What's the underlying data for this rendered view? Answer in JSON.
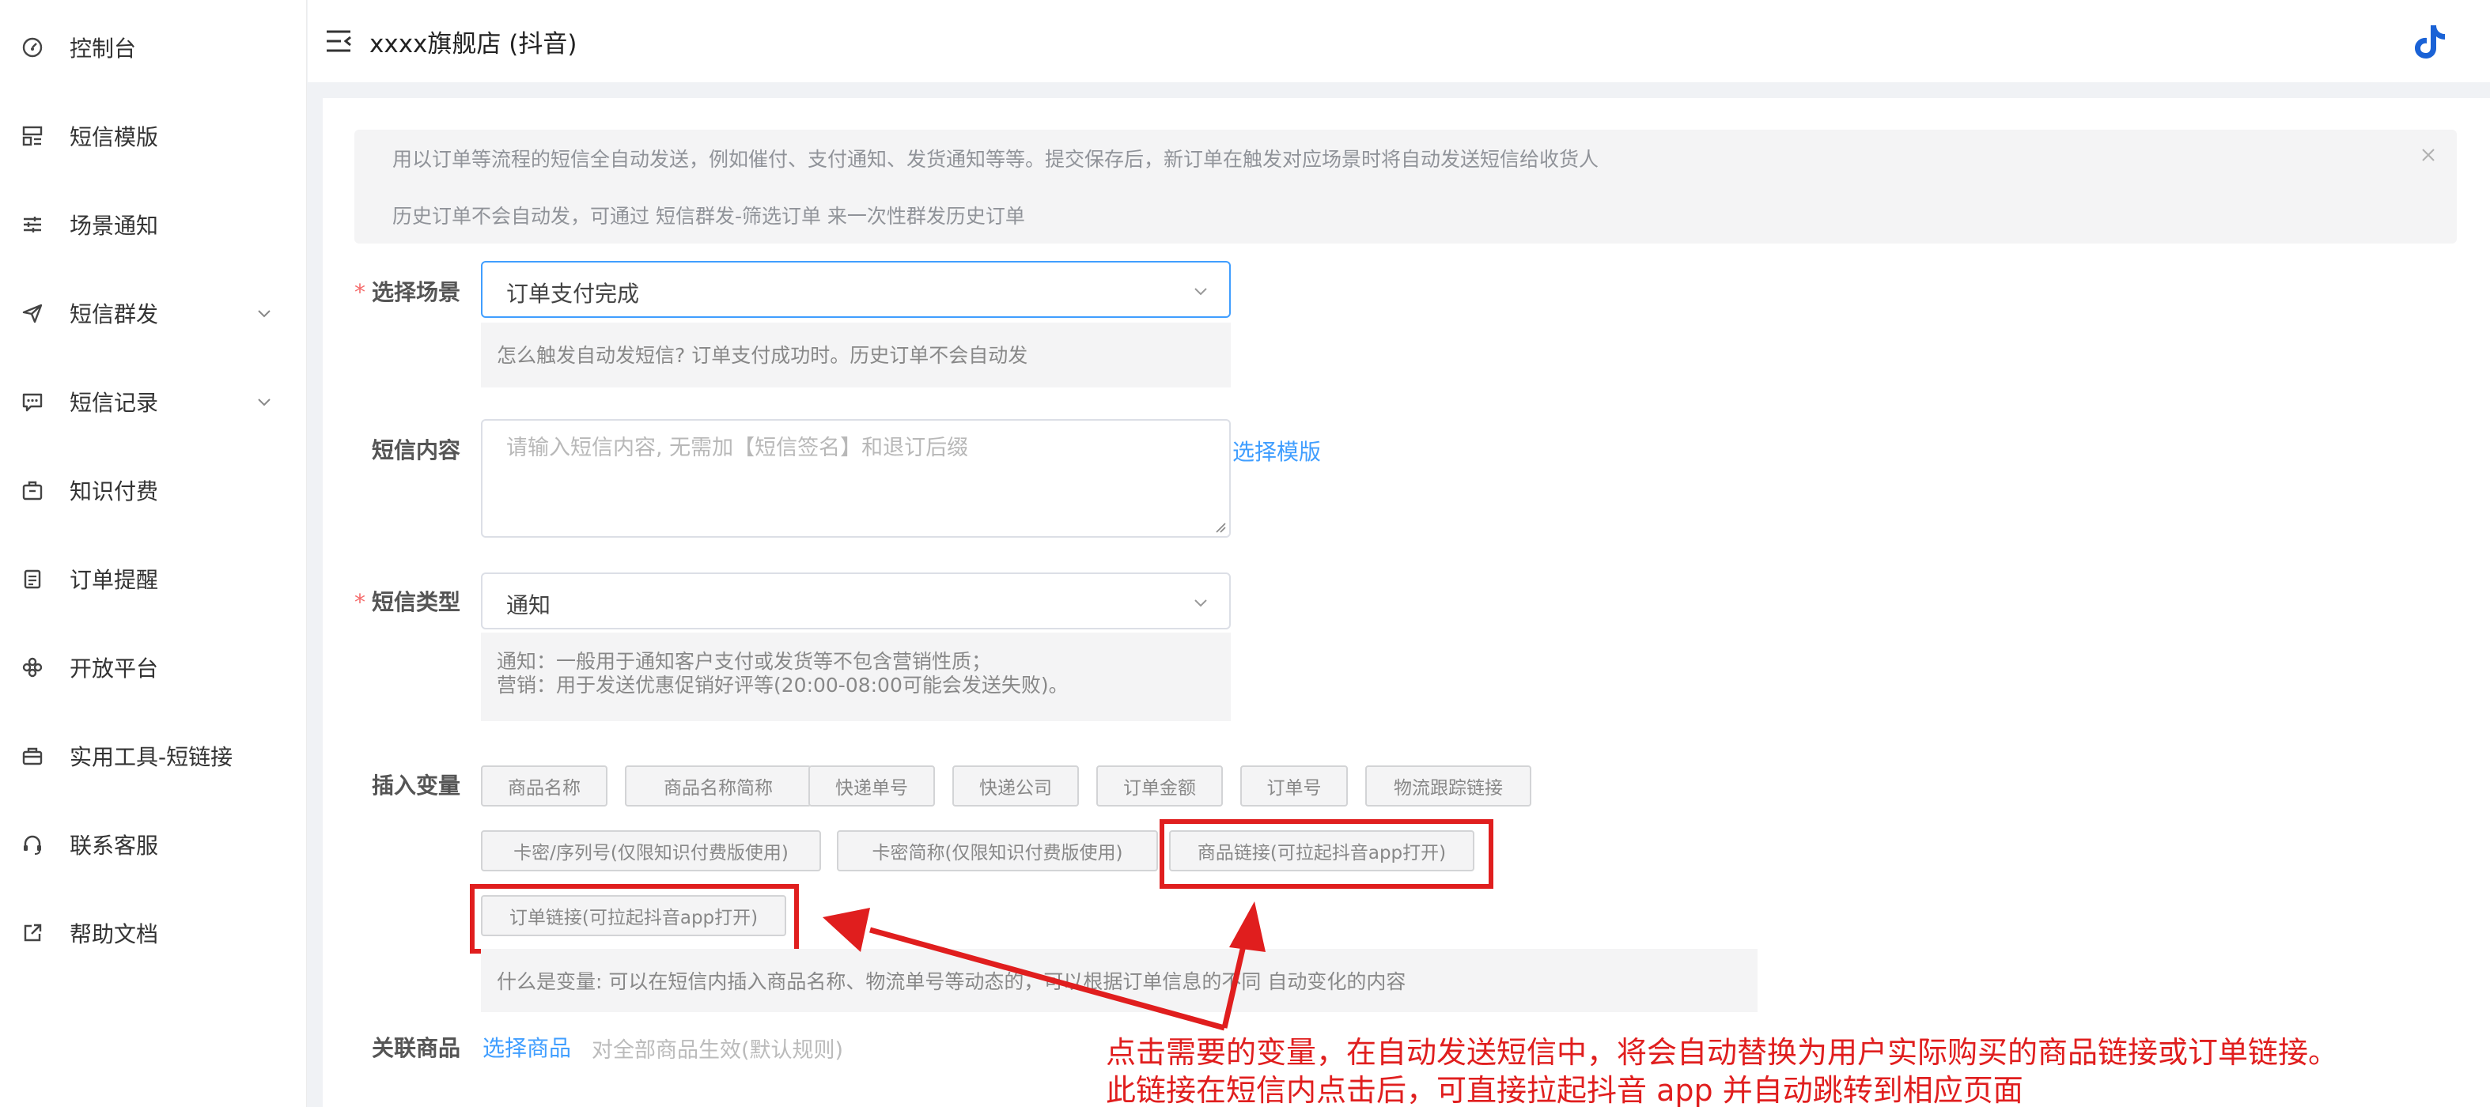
{
  "sidebar": {
    "items": [
      {
        "label": "控制台",
        "icon": "dashboard-icon"
      },
      {
        "label": "短信模版",
        "icon": "template-icon"
      },
      {
        "label": "场景通知",
        "icon": "sliders-icon"
      },
      {
        "label": "短信群发",
        "icon": "send-icon"
      },
      {
        "label": "短信记录",
        "icon": "message-icon"
      },
      {
        "label": "知识付费",
        "icon": "briefcase-icon"
      },
      {
        "label": "订单提醒",
        "icon": "clipboard-icon"
      },
      {
        "label": "开放平台",
        "icon": "puzzle-icon"
      },
      {
        "label": "实用工具-短链接",
        "icon": "toolbox-icon"
      },
      {
        "label": "联系客服",
        "icon": "headset-icon"
      },
      {
        "label": "帮助文档",
        "icon": "external-link-icon"
      }
    ]
  },
  "header": {
    "title": "xxxx旗舰店 (抖音)"
  },
  "alert": {
    "line1": "用以订单等流程的短信全自动发送，例如催付、支付通知、发货通知等等。提交保存后，新订单在触发对应场景时将自动发送短信给收货人",
    "line2": "历史订单不会自动发，可通过 短信群发-筛选订单 来一次性群发历史订单"
  },
  "form": {
    "scene": {
      "label": "选择场景",
      "value": "订单支付完成",
      "tip": "怎么触发自动发短信? 订单支付成功时。历史订单不会自动发"
    },
    "content": {
      "label": "短信内容",
      "placeholder": "请输入短信内容, 无需加【短信签名】和退订后缀",
      "select_template": "选择模版"
    },
    "type": {
      "label": "短信类型",
      "value": "通知",
      "tip_line1": "通知：一般用于通知客户支付或发货等不包含营销性质；",
      "tip_line2": "营销：用于发送优惠促销好评等(20:00-08:00可能会发送失败)。"
    },
    "variables": {
      "label": "插入变量",
      "tags": [
        "商品名称",
        "商品名称简称",
        "快递单号",
        "快递公司",
        "订单金额",
        "订单号",
        "物流跟踪链接",
        "卡密/序列号(仅限知识付费版使用)",
        "卡密简称(仅限知识付费版使用)",
        "商品链接(可拉起抖音app打开)",
        "订单链接(可拉起抖音app打开)"
      ],
      "tip": "什么是变量: 可以在短信内插入商品名称、物流单号等动态的，可以根据订单信息的不同 自动变化的内容"
    },
    "product": {
      "label": "关联商品",
      "select": "选择商品",
      "default": "对全部商品生效(默认规则)"
    }
  },
  "annotation": {
    "line1": "点击需要的变量，在自动发送短信中，将会自动替换为用户实际购买的商品链接或订单链接。",
    "line2": "此链接在短信内点击后，可直接拉起抖音 app 并自动跳转到相应页面"
  },
  "colors": {
    "primary": "#409eff",
    "annotation_red": "#e01e1e",
    "required": "#f56c6c"
  }
}
